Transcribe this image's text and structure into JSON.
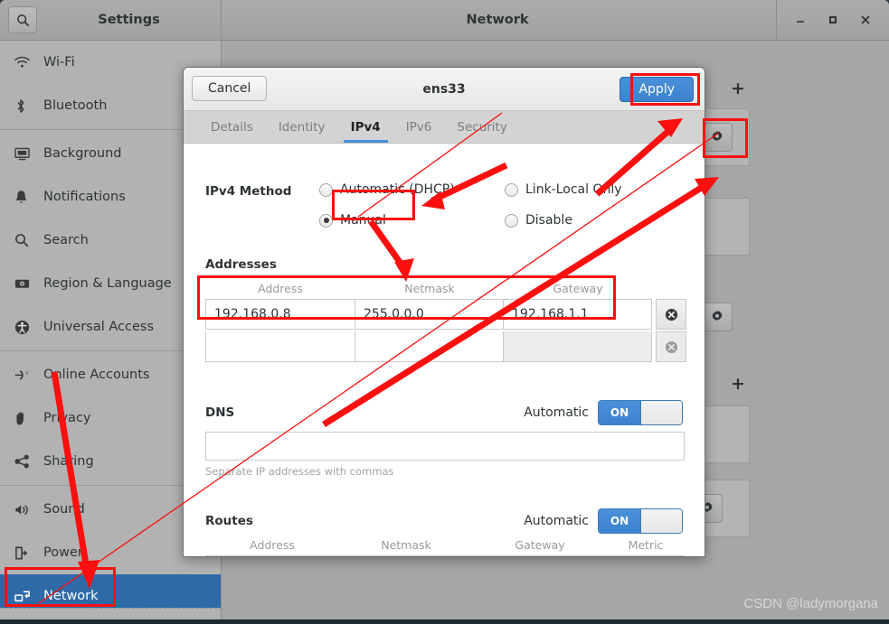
{
  "window": {
    "app_title": "Settings",
    "page_title": "Network",
    "search_icon": "search-icon",
    "controls": {
      "minimize": "–",
      "maximize": "□",
      "close": "✕"
    }
  },
  "sidebar": {
    "items": [
      {
        "label": "Wi-Fi",
        "icon": "wifi-icon",
        "selected": false
      },
      {
        "label": "Bluetooth",
        "icon": "bluetooth-icon",
        "selected": false
      },
      {
        "label": "Background",
        "icon": "background-icon",
        "selected": false
      },
      {
        "label": "Notifications",
        "icon": "bell-icon",
        "selected": false
      },
      {
        "label": "Search",
        "icon": "search-icon",
        "selected": false
      },
      {
        "label": "Region & Language",
        "icon": "keyboard-icon",
        "selected": false
      },
      {
        "label": "Universal Access",
        "icon": "accessibility-icon",
        "selected": false
      },
      {
        "label": "Online Accounts",
        "icon": "online-accounts-icon",
        "selected": false
      },
      {
        "label": "Privacy",
        "icon": "hand-icon",
        "selected": false
      },
      {
        "label": "Sharing",
        "icon": "share-icon",
        "selected": false
      },
      {
        "label": "Sound",
        "icon": "speaker-icon",
        "selected": false
      },
      {
        "label": "Power",
        "icon": "power-plug-icon",
        "selected": false
      },
      {
        "label": "Network",
        "icon": "network-icon",
        "selected": true
      }
    ]
  },
  "content": {
    "add_label": "+",
    "gear_label": "⚙"
  },
  "dialog": {
    "title": "ens33",
    "cancel_label": "Cancel",
    "apply_label": "Apply",
    "tabs": [
      {
        "label": "Details",
        "active": false
      },
      {
        "label": "Identity",
        "active": false
      },
      {
        "label": "IPv4",
        "active": true
      },
      {
        "label": "IPv6",
        "active": false
      },
      {
        "label": "Security",
        "active": false
      }
    ],
    "ipv4_method": {
      "label": "IPv4 Method",
      "options": [
        {
          "label": "Automatic (DHCP)",
          "selected": false
        },
        {
          "label": "Manual",
          "selected": true
        },
        {
          "label": "Link-Local Only",
          "selected": false
        },
        {
          "label": "Disable",
          "selected": false
        }
      ]
    },
    "addresses": {
      "title": "Addresses",
      "columns": [
        "Address",
        "Netmask",
        "Gateway"
      ],
      "rows": [
        {
          "address": "192.168.0.8",
          "netmask": "255.0.0.0",
          "gateway": "192.168.1.1",
          "empty": false
        },
        {
          "address": "",
          "netmask": "",
          "gateway": "",
          "empty": true
        }
      ]
    },
    "dns": {
      "title": "DNS",
      "automatic_label": "Automatic",
      "toggle_state": "ON",
      "value": "",
      "hint": "Separate IP addresses with commas"
    },
    "routes": {
      "title": "Routes",
      "automatic_label": "Automatic",
      "toggle_state": "ON",
      "columns": [
        "Address",
        "Netmask",
        "Gateway",
        "Metric"
      ],
      "rows": [
        {
          "address": "",
          "netmask": "",
          "gateway": "",
          "metric": "",
          "empty": true
        }
      ]
    }
  },
  "annotations": {
    "highlight_color": "#fb0f0f",
    "boxes": [
      "apply-button",
      "manual-radio",
      "address-row",
      "settings-gear-button",
      "network-sidebar-item"
    ]
  },
  "watermark": "CSDN @ladymorgana"
}
